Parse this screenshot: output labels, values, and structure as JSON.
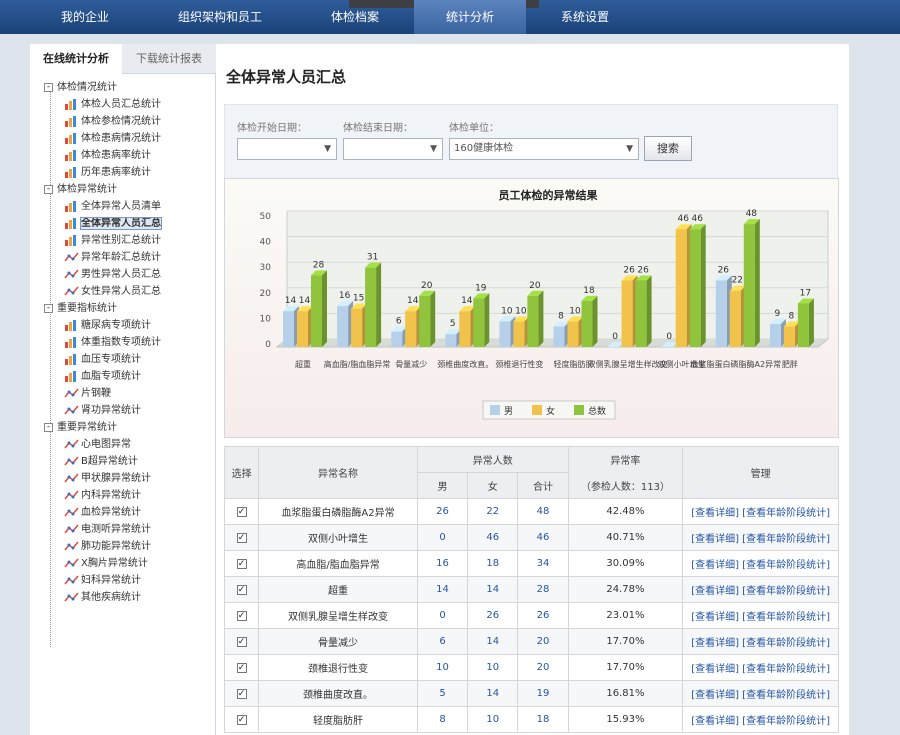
{
  "nav": {
    "tabs": [
      "我的企业",
      "组织架构和员工",
      "体检档案",
      "统计分析",
      "系统设置"
    ],
    "active_index": 3
  },
  "sidebar": {
    "tabs": [
      "在线统计分析",
      "下载统计报表"
    ],
    "groups": [
      {
        "label": "体检情况统计",
        "items": [
          "体检人员汇总统计",
          "体检参检情况统计",
          "体检患病情况统计",
          "体检患病率统计",
          "历年患病率统计"
        ]
      },
      {
        "label": "体检异常统计",
        "items": [
          "全体异常人员清单",
          "全体异常人员汇总",
          "异常性别汇总统计",
          "异常年龄汇总统计",
          "男性异常人员汇总",
          "女性异常人员汇总"
        ]
      },
      {
        "label": "重要指标统计",
        "items": [
          "糖尿病专项统计",
          "体重指数专项统计",
          "血压专项统计",
          "血脂专项统计",
          "片钢鞭",
          "肾功异常统计"
        ]
      },
      {
        "label": "重要异常统计",
        "items": [
          "心电图异常",
          "B超异常统计",
          "甲状腺异常统计",
          "内科异常统计",
          "血检异常统计",
          "电测听异常统计",
          "肺功能异常统计",
          "X胸片异常统计",
          "妇科异常统计",
          "其他疾病统计"
        ]
      }
    ],
    "selected_item": "全体异常人员汇总"
  },
  "main": {
    "title": "全体异常人员汇总",
    "filter": {
      "start_label": "体检开始日期：",
      "start_value": "",
      "end_label": "体检结束日期：",
      "end_value": "",
      "unit_label": "体检单位：",
      "unit_value": "160健康体检",
      "search_label": "搜索"
    }
  },
  "chart_data": {
    "type": "bar",
    "title": "员工体检的异常结果",
    "ylim": [
      0,
      50
    ],
    "yticks": [
      0,
      10,
      20,
      30,
      40,
      50
    ],
    "categories": [
      "超重",
      "高血脂/脂血脂异常",
      "骨量减少",
      "颈椎曲度改直。",
      "颈椎退行性变",
      "轻度脂肪肝",
      "双侧乳腺呈增生样改变",
      "双侧小叶增生",
      "血浆脂蛋白磷脂酶A2异常",
      "肥胖"
    ],
    "series": [
      {
        "name": "男",
        "color": "#b7d0ea",
        "values": [
          14,
          16,
          6,
          5,
          10,
          8,
          0,
          0,
          26,
          9
        ]
      },
      {
        "name": "女",
        "color": "#f2c34a",
        "values": [
          14,
          15,
          14,
          14,
          10,
          10,
          26,
          46,
          22,
          8
        ]
      },
      {
        "name": "总数",
        "color": "#8fc43c",
        "values": [
          28,
          31,
          20,
          19,
          20,
          18,
          26,
          46,
          48,
          17
        ]
      }
    ],
    "legend_position": "bottom"
  },
  "table": {
    "headers": {
      "select": "选择",
      "name": "异常名称",
      "count_group": "异常人数",
      "male": "男",
      "female": "女",
      "total": "合计",
      "rate": "异常率",
      "rate_sub": "（参检人数：113）",
      "manage": "管理"
    },
    "link_label": "[查看详细] [查看年龄阶段统计]",
    "rows": [
      {
        "name": "血浆脂蛋白磷脂酶A2异常",
        "male": "26",
        "female": "22",
        "total": "48",
        "rate": "42.48%"
      },
      {
        "name": "双侧小叶增生",
        "male": "0",
        "female": "46",
        "total": "46",
        "rate": "40.71%"
      },
      {
        "name": "高血脂/脂血脂异常",
        "male": "16",
        "female": "18",
        "total": "34",
        "rate": "30.09%"
      },
      {
        "name": "超重",
        "male": "14",
        "female": "14",
        "total": "28",
        "rate": "24.78%"
      },
      {
        "name": "双侧乳腺呈增生样改变",
        "male": "0",
        "female": "26",
        "total": "26",
        "rate": "23.01%"
      },
      {
        "name": "骨量减少",
        "male": "6",
        "female": "14",
        "total": "20",
        "rate": "17.70%"
      },
      {
        "name": "颈椎退行性变",
        "male": "10",
        "female": "10",
        "total": "20",
        "rate": "17.70%"
      },
      {
        "name": "颈椎曲度改直。",
        "male": "5",
        "female": "14",
        "total": "19",
        "rate": "16.81%"
      },
      {
        "name": "轻度脂肪肝",
        "male": "8",
        "female": "10",
        "total": "18",
        "rate": "15.93%"
      }
    ]
  },
  "colors": {
    "nav_bg": "#1f4a87",
    "link": "#2455a4",
    "male": "#b7d0ea",
    "female": "#f2c34a",
    "total": "#8fc43c"
  }
}
